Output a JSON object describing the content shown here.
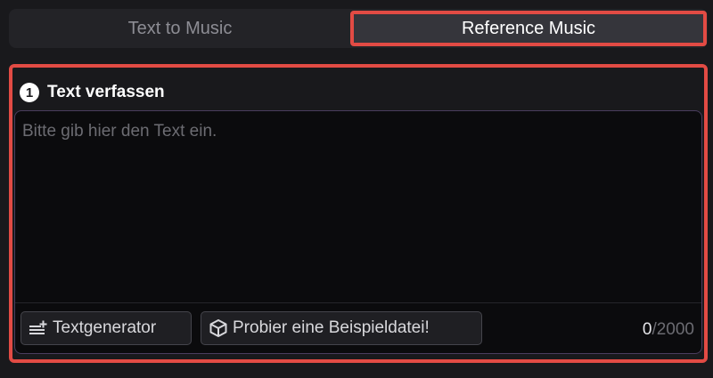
{
  "tabs": [
    {
      "label": "Text to Music",
      "active": false
    },
    {
      "label": "Reference Music",
      "active": true
    }
  ],
  "section": {
    "step_number": "1",
    "title": "Text verfassen"
  },
  "editor": {
    "value": "",
    "placeholder": "Bitte gib hier den Text ein."
  },
  "actions": {
    "text_generator_label": "Textgenerator",
    "example_label": "Probier eine Beispieldatei!"
  },
  "counter": {
    "current": "0",
    "max": "/2000"
  },
  "colors": {
    "highlight": "#e24b44",
    "background": "#19191c",
    "editor_border": "#4a3d5e"
  }
}
